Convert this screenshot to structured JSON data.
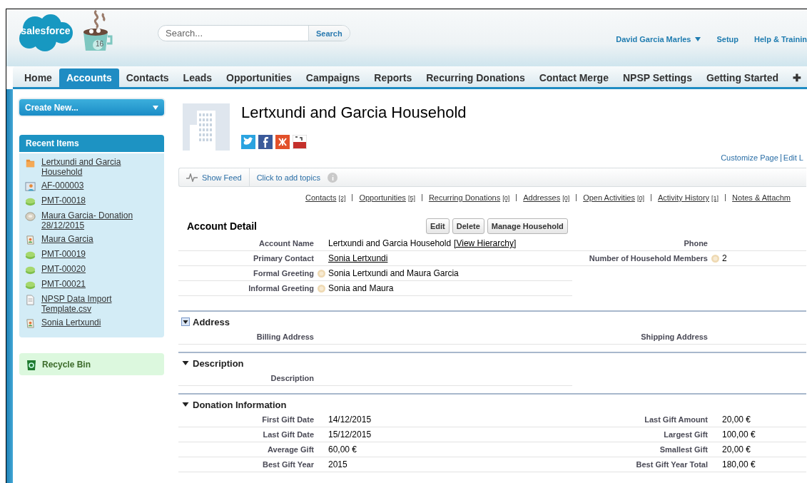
{
  "header": {
    "logo": "salesforce",
    "badge": "16",
    "search": {
      "placeholder": "Search...",
      "button": "Search"
    },
    "user": "David Garcia Marles",
    "links": [
      "Setup",
      "Help & Trainin"
    ]
  },
  "tabs": [
    {
      "label": "Home",
      "selected": false
    },
    {
      "label": "Accounts",
      "selected": true
    },
    {
      "label": "Contacts",
      "selected": false
    },
    {
      "label": "Leads",
      "selected": false
    },
    {
      "label": "Opportunities",
      "selected": false
    },
    {
      "label": "Campaigns",
      "selected": false
    },
    {
      "label": "Reports",
      "selected": false
    },
    {
      "label": "Recurring Donations",
      "selected": false
    },
    {
      "label": "Contact Merge",
      "selected": false
    },
    {
      "label": "NPSP Settings",
      "selected": false
    },
    {
      "label": "Getting Started",
      "selected": false
    }
  ],
  "add_tab": "✚",
  "sidebar": {
    "create_new": "Create New...",
    "recent_title": "Recent Items",
    "recent_items": [
      {
        "label": "Lertxundi and Garcia Household",
        "kind": "household"
      },
      {
        "label": "AF-000003",
        "kind": "affiliation"
      },
      {
        "label": "PMT-00018",
        "kind": "payment"
      },
      {
        "label": "Maura Garcia- Donation 28/12/2015",
        "kind": "opportunity"
      },
      {
        "label": "Maura Garcia",
        "kind": "contact"
      },
      {
        "label": "PMT-00019",
        "kind": "payment"
      },
      {
        "label": "PMT-00020",
        "kind": "payment"
      },
      {
        "label": "PMT-00021",
        "kind": "payment"
      },
      {
        "label": "NPSP Data Import Template.csv",
        "kind": "document"
      },
      {
        "label": "Sonia Lertxundi",
        "kind": "contact"
      }
    ],
    "recycle_bin": "Recycle Bin"
  },
  "record": {
    "title": "Lertxundi and Garcia Household",
    "page_links": [
      "Customize Page",
      "Edit L"
    ],
    "feed": {
      "show_feed": "Show Feed",
      "topics": "Click to add topics"
    },
    "related_links": [
      {
        "label": "Contacts",
        "count": "[2]"
      },
      {
        "label": "Opportunities",
        "count": "[5]"
      },
      {
        "label": "Recurring Donations",
        "count": "[0]"
      },
      {
        "label": "Addresses",
        "count": "[0]"
      },
      {
        "label": "Open Activities",
        "count": "[0]"
      },
      {
        "label": "Activity History",
        "count": "[1]"
      },
      {
        "label": "Notes & Attachm"
      }
    ]
  },
  "detail": {
    "title": "Account Detail",
    "buttons": [
      "Edit",
      "Delete",
      "Manage Household"
    ],
    "rows": [
      {
        "left": {
          "label": "Account Name",
          "value": "Lertxundi and Garcia Household",
          "link": "[View Hierarchy]"
        },
        "right": {
          "label": "Phone"
        }
      },
      {
        "left": {
          "label": "Primary Contact",
          "value": "Sonia Lertxundi",
          "is_link": true
        },
        "right": {
          "label": "Number of Household Members",
          "value": "2",
          "help": true
        }
      },
      {
        "left": {
          "label": "Formal Greeting",
          "value": "Sonia Lertxundi and Maura Garcia",
          "help": true
        }
      },
      {
        "left": {
          "label": "Informal Greeting",
          "value": "Sonia and Maura",
          "help": true
        }
      }
    ]
  },
  "sections": [
    {
      "title": "Address",
      "boxed_toggle": true,
      "rows": [
        {
          "left": {
            "label": "Billing Address"
          },
          "right": {
            "label": "Shipping Address"
          }
        }
      ]
    },
    {
      "title": "Description",
      "boxed_toggle": false,
      "rows": [
        {
          "left": {
            "label": "Description"
          }
        }
      ]
    },
    {
      "title": "Donation Information",
      "boxed_toggle": false,
      "rows": [
        {
          "left": {
            "label": "First Gift Date",
            "value": "14/12/2015"
          },
          "right": {
            "label": "Last Gift Amount",
            "value": "20,00 €"
          }
        },
        {
          "left": {
            "label": "Last Gift Date",
            "value": "15/12/2015"
          },
          "right": {
            "label": "Largest Gift",
            "value": "100,00 €"
          }
        },
        {
          "left": {
            "label": "Average Gift",
            "value": "60,00 €"
          },
          "right": {
            "label": "Smallest Gift",
            "value": "20,00 €"
          }
        },
        {
          "left": {
            "label": "Best Gift Year",
            "value": "2015"
          },
          "right": {
            "label": "Best Gift Year Total",
            "value": "180,00 €"
          }
        }
      ]
    }
  ]
}
